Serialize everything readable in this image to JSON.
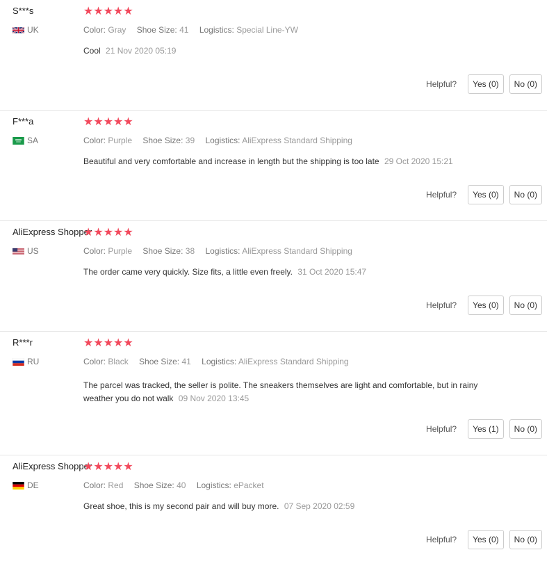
{
  "labels": {
    "color": "Color:",
    "shoe_size": "Shoe Size:",
    "logistics": "Logistics:",
    "helpful": "Helpful?"
  },
  "colors": {
    "star": "#f2495c"
  },
  "reviews": [
    {
      "name": "S***s",
      "flag_icon": "uk-flag-icon",
      "country": "UK",
      "rating": 5,
      "stars": "★★★★★",
      "color": "Gray",
      "shoe_size": "41",
      "logistics": "Special Line-YW",
      "text": "Cool",
      "date": "21 Nov 2020 05:19",
      "yes": "Yes (0)",
      "no": "No (0)"
    },
    {
      "name": "F***a",
      "flag_icon": "sa-flag-icon",
      "country": "SA",
      "rating": 5,
      "stars": "★★★★★",
      "color": "Purple",
      "shoe_size": "39",
      "logistics": "AliExpress Standard Shipping",
      "text": "Beautiful and very comfortable and increase in length but the shipping is too late",
      "date": "29 Oct 2020 15:21",
      "yes": "Yes (0)",
      "no": "No (0)"
    },
    {
      "name": "AliExpress Shopper",
      "flag_icon": "us-flag-icon",
      "country": "US",
      "rating": 5,
      "stars": "★★★★★",
      "color": "Purple",
      "shoe_size": "38",
      "logistics": "AliExpress Standard Shipping",
      "text": "The order came very quickly. Size fits, a little even freely.",
      "date": "31 Oct 2020 15:47",
      "yes": "Yes (0)",
      "no": "No (0)"
    },
    {
      "name": "R***r",
      "flag_icon": "ru-flag-icon",
      "country": "RU",
      "rating": 5,
      "stars": "★★★★★",
      "color": "Black",
      "shoe_size": "41",
      "logistics": "AliExpress Standard Shipping",
      "text": "The parcel was tracked, the seller is polite. The sneakers themselves are light and comfortable, but in rainy weather you do not walk",
      "date": "09 Nov 2020 13:45",
      "yes": "Yes (1)",
      "no": "No (0)"
    },
    {
      "name": "AliExpress Shopper",
      "flag_icon": "de-flag-icon",
      "country": "DE",
      "rating": 5,
      "stars": "★★★★★",
      "color": "Red",
      "shoe_size": "40",
      "logistics": "ePacket",
      "text": "Great shoe, this is my second pair and will buy more.",
      "date": "07 Sep 2020 02:59",
      "yes": "Yes (0)",
      "no": "No (0)"
    }
  ]
}
